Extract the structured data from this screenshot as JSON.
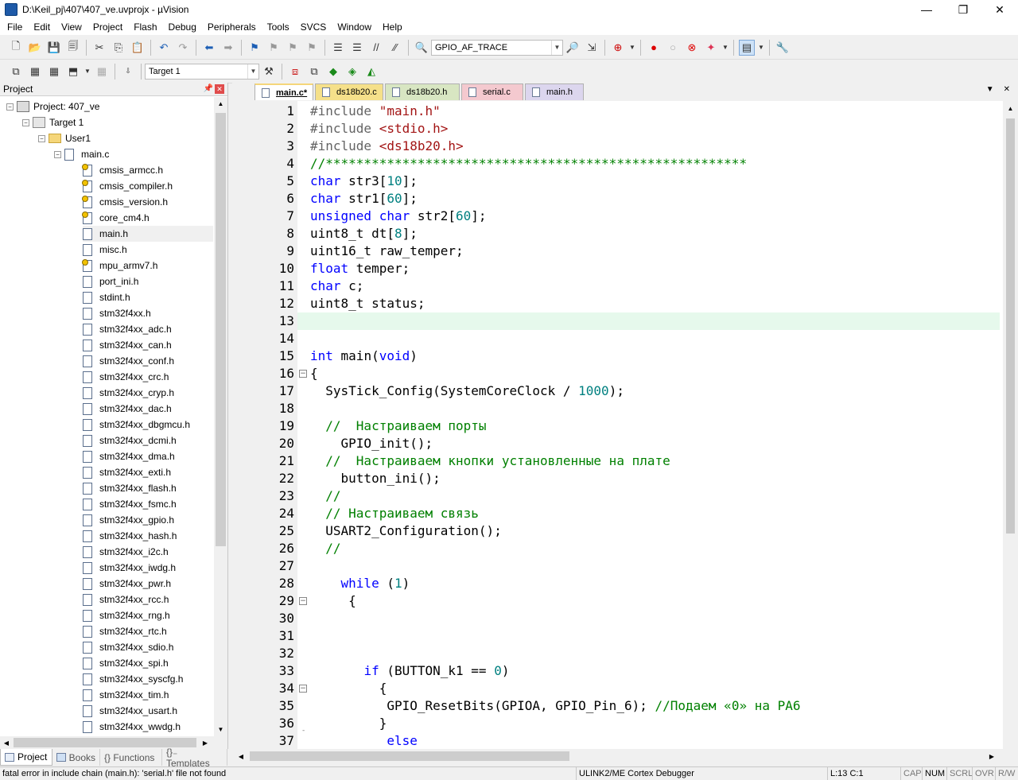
{
  "window": {
    "title": "D:\\Keil_pj\\407\\407_ve.uvprojx - µVision",
    "min": "—",
    "max": "❐",
    "close": "✕"
  },
  "menu": [
    "File",
    "Edit",
    "View",
    "Project",
    "Flash",
    "Debug",
    "Peripherals",
    "Tools",
    "SVCS",
    "Window",
    "Help"
  ],
  "toolbar": {
    "find_combo": "GPIO_AF_TRACE",
    "target_combo": "Target 1"
  },
  "project_panel": {
    "title": "Project",
    "project": "Project: 407_ve",
    "target": "Target 1",
    "group": "User1",
    "source": "main.c",
    "headers": [
      "cmsis_armcc.h",
      "cmsis_compiler.h",
      "cmsis_version.h",
      "core_cm4.h",
      "main.h",
      "misc.h",
      "mpu_armv7.h",
      "port_ini.h",
      "stdint.h",
      "stm32f4xx.h",
      "stm32f4xx_adc.h",
      "stm32f4xx_can.h",
      "stm32f4xx_conf.h",
      "stm32f4xx_crc.h",
      "stm32f4xx_cryp.h",
      "stm32f4xx_dac.h",
      "stm32f4xx_dbgmcu.h",
      "stm32f4xx_dcmi.h",
      "stm32f4xx_dma.h",
      "stm32f4xx_exti.h",
      "stm32f4xx_flash.h",
      "stm32f4xx_fsmc.h",
      "stm32f4xx_gpio.h",
      "stm32f4xx_hash.h",
      "stm32f4xx_i2c.h",
      "stm32f4xx_iwdg.h",
      "stm32f4xx_pwr.h",
      "stm32f4xx_rcc.h",
      "stm32f4xx_rng.h",
      "stm32f4xx_rtc.h",
      "stm32f4xx_sdio.h",
      "stm32f4xx_spi.h",
      "stm32f4xx_syscfg.h",
      "stm32f4xx_tim.h",
      "stm32f4xx_usart.h",
      "stm32f4xx_wwdg.h"
    ],
    "tabs": [
      "Project",
      "Books",
      "{} Functions",
      "{}₋ Templates"
    ]
  },
  "editor_tabs": [
    {
      "label": "main.c*",
      "color": "#dce7f7"
    },
    {
      "label": "ds18b20.c",
      "color": "#f5e08a"
    },
    {
      "label": "ds18b20.h",
      "color": "#d8e6c2"
    },
    {
      "label": "serial.c",
      "color": "#f4c9cf"
    },
    {
      "label": "main.h",
      "color": "#dcd6ee"
    }
  ],
  "code_lines": [
    "1",
    "2",
    "3",
    "4",
    "5",
    "6",
    "7",
    "8",
    "9",
    "10",
    "11",
    "12",
    "13",
    "14",
    "15",
    "16",
    "17",
    "18",
    "19",
    "20",
    "21",
    "22",
    "23",
    "24",
    "25",
    "26",
    "27",
    "28",
    "29",
    "30",
    "31",
    "32",
    "33",
    "34",
    "35",
    "36",
    "37"
  ],
  "code": {
    "l1a": "#include ",
    "l1b": "\"main.h\"",
    "l2a": "#include ",
    "l2b": "<stdio.h>",
    "l3a": "#include ",
    "l3b": "<ds18b20.h>",
    "l4": "//*******************************************************",
    "l5a": "char",
    "l5b": " str3[",
    "l5c": "10",
    "l5d": "];",
    "l6a": "char",
    "l6b": " str1[",
    "l6c": "60",
    "l6d": "];",
    "l7a": "unsigned",
    "l7b": " ",
    "l7c": "char",
    "l7d": " str2[",
    "l7e": "60",
    "l7f": "];",
    "l8a": "uint8_t dt[",
    "l8b": "8",
    "l8c": "];",
    "l9": "uint16_t raw_temper;",
    "l10a": "float",
    "l10b": " temper;",
    "l11a": "char",
    "l11b": " c;",
    "l12": "uint8_t status;",
    "l15a": "int",
    "l15b": " main(",
    "l15c": "void",
    "l15d": ")",
    "l16": "{",
    "l17a": "  SysTick_Config(SystemCoreClock / ",
    "l17b": "1000",
    "l17c": ");",
    "l19": "  //  Настраиваем порты",
    "l20": "    GPIO_init();",
    "l21": "  //  Настраиваем кнопки установленные на плате",
    "l22": "    button_ini();",
    "l23": "  //",
    "l24": "  // Настраиваем связь",
    "l25": "  USART2_Configuration();",
    "l26": "  //",
    "l28a": "    ",
    "l28b": "while",
    "l28c": " (",
    "l28d": "1",
    "l28e": ")",
    "l29": "     {",
    "l33a": "       ",
    "l33b": "if",
    "l33c": " (BUTTON_k1 == ",
    "l33d": "0",
    "l33e": ")",
    "l34": "         {",
    "l35a": "          GPIO_ResetBits(GPIOA, GPIO_Pin_6); ",
    "l35b": "//Подаем «0» на PA6",
    "l36": "         }",
    "l37a": "          ",
    "l37b": "else"
  },
  "status": {
    "message": "fatal error in include chain (main.h): 'serial.h' file not found",
    "debugger": "ULINK2/ME Cortex Debugger",
    "position": "L:13 C:1",
    "cap": "CAP",
    "num": "NUM",
    "scrl": "SCRL",
    "ovr": "OVR",
    "rw": "R/W"
  }
}
